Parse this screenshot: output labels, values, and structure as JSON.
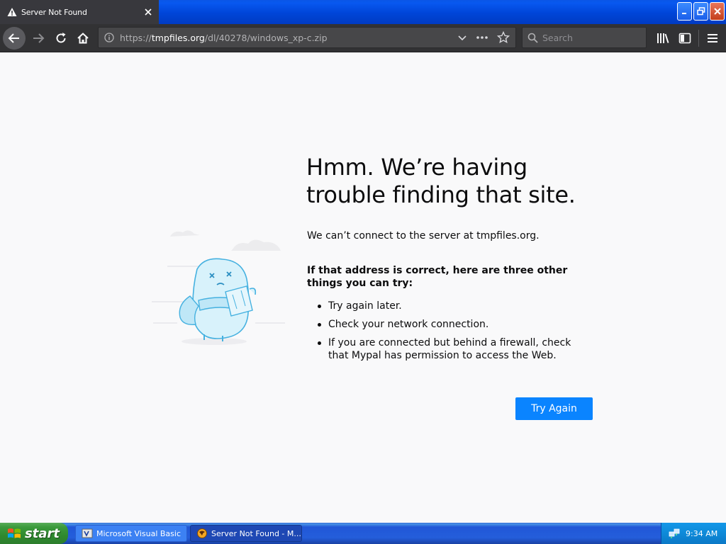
{
  "tab": {
    "title": "Server Not Found"
  },
  "navbar": {
    "url_prefix": "https://",
    "url_domain": "tmpfiles.org",
    "url_path": "/dl/40278/windows_xp-c.zip",
    "search_placeholder": "Search"
  },
  "page": {
    "title": "Hmm. We’re having trouble finding that site.",
    "description": "We can’t connect to the server at tmpfiles.org.",
    "tips_heading": "If that address is correct, here are three other things you can try:",
    "tips": [
      "Try again later.",
      "Check your network connection.",
      "If you are connected but behind a firewall, check that Mypal has permission to access the Web."
    ],
    "try_again_label": "Try Again"
  },
  "taskbar": {
    "start_label": "start",
    "items": [
      "Microsoft Visual Basic",
      "Server Not Found - M..."
    ],
    "clock": "9:34 AM"
  },
  "colors": {
    "accent": "#0a84ff",
    "toolbar": "#323234",
    "tab": "#38383d",
    "xp_blue": "#245edb",
    "xp_green": "#3c9a3c"
  }
}
